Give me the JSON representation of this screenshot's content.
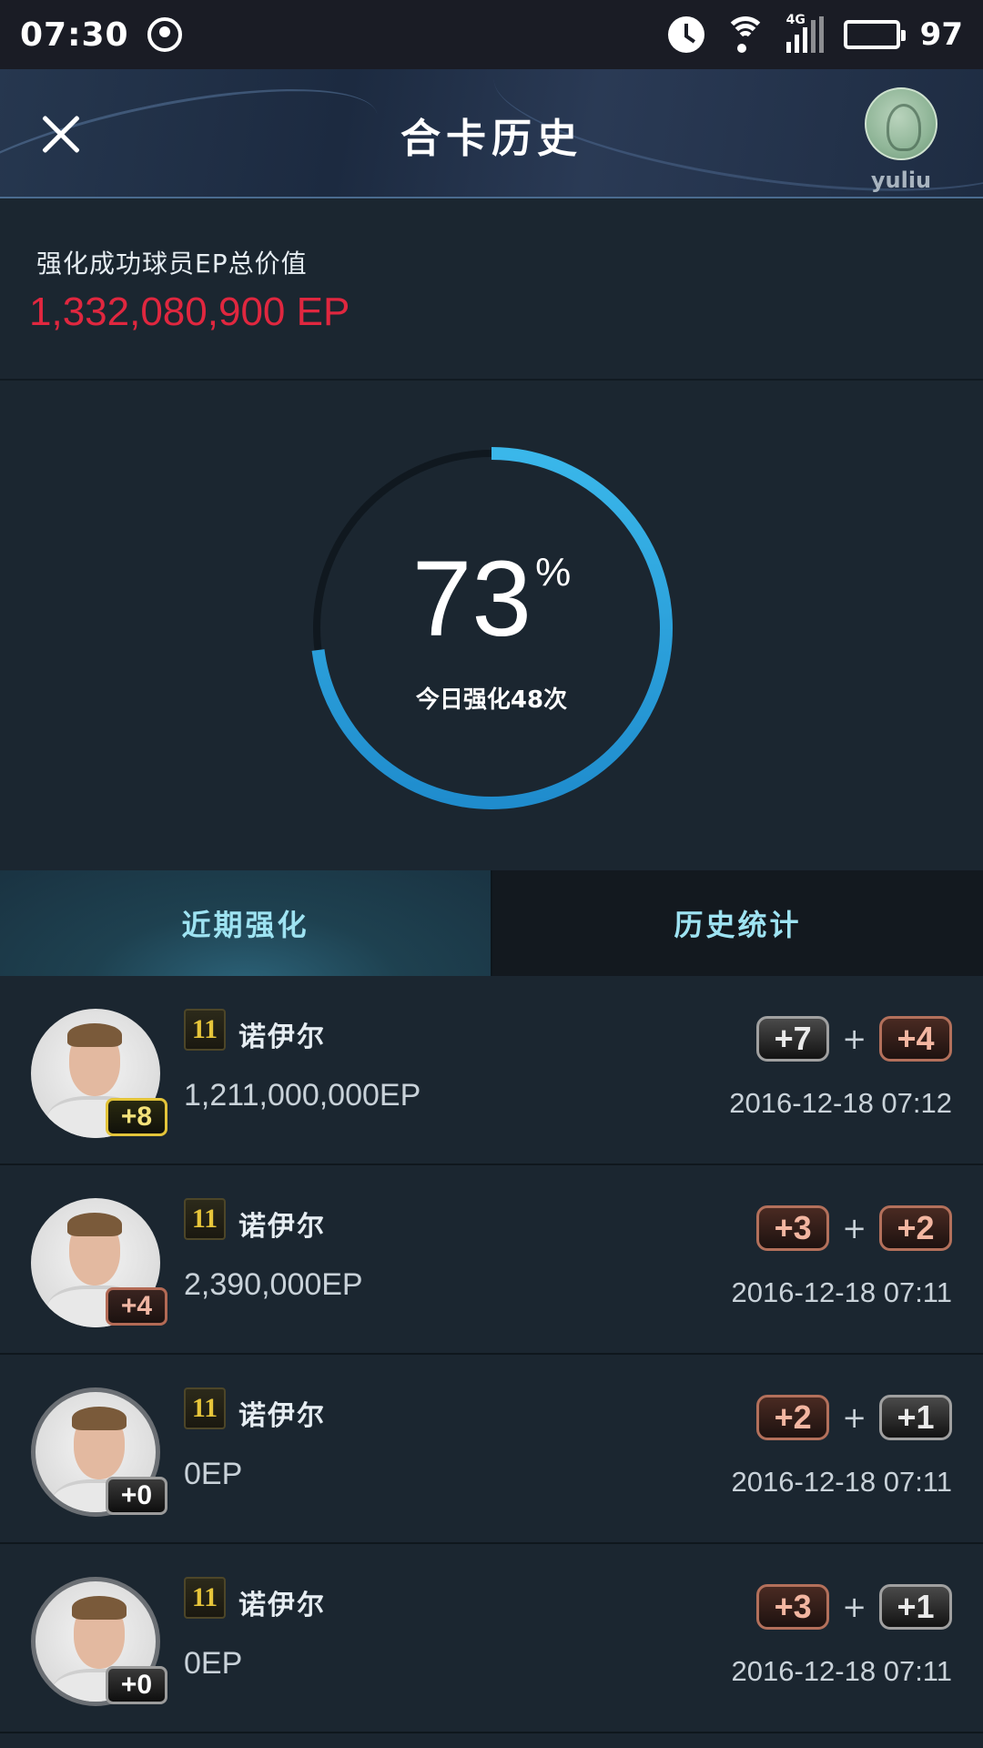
{
  "status_bar": {
    "time": "07:30",
    "network": "4G",
    "battery": "97"
  },
  "header": {
    "title": "合卡历史",
    "username": "yuliu"
  },
  "summary": {
    "label": "强化成功球员EP总价值",
    "value": "1,332,080,900 EP"
  },
  "gauge": {
    "percent": "73",
    "percent_sign": "%",
    "progress": 0.73,
    "subtitle": "今日强化48次",
    "arc_color": "#2aa6de",
    "track_color": "#10181f"
  },
  "tabs": [
    {
      "label": "近期强化",
      "active": true
    },
    {
      "label": "历史统计",
      "active": false
    }
  ],
  "records": [
    {
      "name": "诺伊尔",
      "season": "11",
      "level": "+8",
      "level_style": "gold",
      "ep": "1,211,000,000EP",
      "combo": [
        {
          "v": "+7",
          "s": "black"
        },
        {
          "v": "+4",
          "s": "bronze"
        }
      ],
      "plus": "+",
      "date": "2016-12-18 07:12"
    },
    {
      "name": "诺伊尔",
      "season": "11",
      "level": "+4",
      "level_style": "bronze",
      "ep": "2,390,000EP",
      "combo": [
        {
          "v": "+3",
          "s": "bronze"
        },
        {
          "v": "+2",
          "s": "bronze"
        }
      ],
      "plus": "+",
      "date": "2016-12-18 07:11"
    },
    {
      "name": "诺伊尔",
      "season": "11",
      "level": "+0",
      "level_style": "black",
      "ep": "0EP",
      "combo": [
        {
          "v": "+2",
          "s": "bronze"
        },
        {
          "v": "+1",
          "s": "black"
        }
      ],
      "plus": "+",
      "date": "2016-12-18 07:11"
    },
    {
      "name": "诺伊尔",
      "season": "11",
      "level": "+0",
      "level_style": "black",
      "ep": "0EP",
      "combo": [
        {
          "v": "+3",
          "s": "bronze"
        },
        {
          "v": "+1",
          "s": "black"
        }
      ],
      "plus": "+",
      "date": "2016-12-18 07:11"
    }
  ]
}
